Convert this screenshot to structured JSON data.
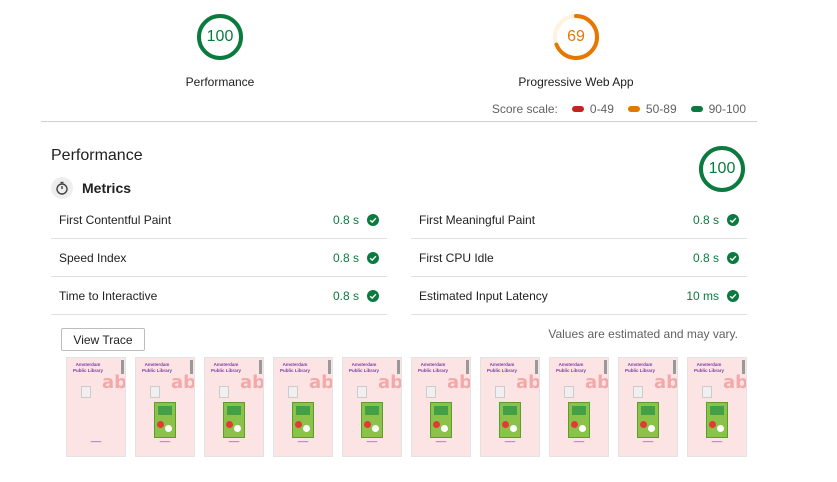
{
  "summary": {
    "gauges": [
      {
        "value": "100",
        "label": "Performance",
        "score": 100,
        "color": "#0b7a3e"
      },
      {
        "value": "69",
        "label": "Progressive Web App",
        "score": 69,
        "color": "#e67700"
      }
    ]
  },
  "score_scale": {
    "label": "Score scale:",
    "ranges": [
      {
        "label": "0-49",
        "color": "#c7221f"
      },
      {
        "label": "50-89",
        "color": "#e67700"
      },
      {
        "label": "90-100",
        "color": "#0b7a3e"
      }
    ]
  },
  "performance": {
    "title": "Performance",
    "score": "100",
    "metrics_title": "Metrics",
    "metrics_left": [
      {
        "name": "First Contentful Paint",
        "value": "0.8 s"
      },
      {
        "name": "Speed Index",
        "value": "0.8 s"
      },
      {
        "name": "Time to Interactive",
        "value": "0.8 s"
      }
    ],
    "metrics_right": [
      {
        "name": "First Meaningful Paint",
        "value": "0.8 s"
      },
      {
        "name": "First CPU Idle",
        "value": "0.8 s"
      },
      {
        "name": "Estimated Input Latency",
        "value": "10 ms"
      }
    ],
    "view_trace_label": "View Trace",
    "estimate_note": "Values are estimated and may vary."
  },
  "filmstrip": {
    "frame_count": 10,
    "frame_text": {
      "library": "Amsterdam Public Library",
      "letters": "ab"
    }
  }
}
